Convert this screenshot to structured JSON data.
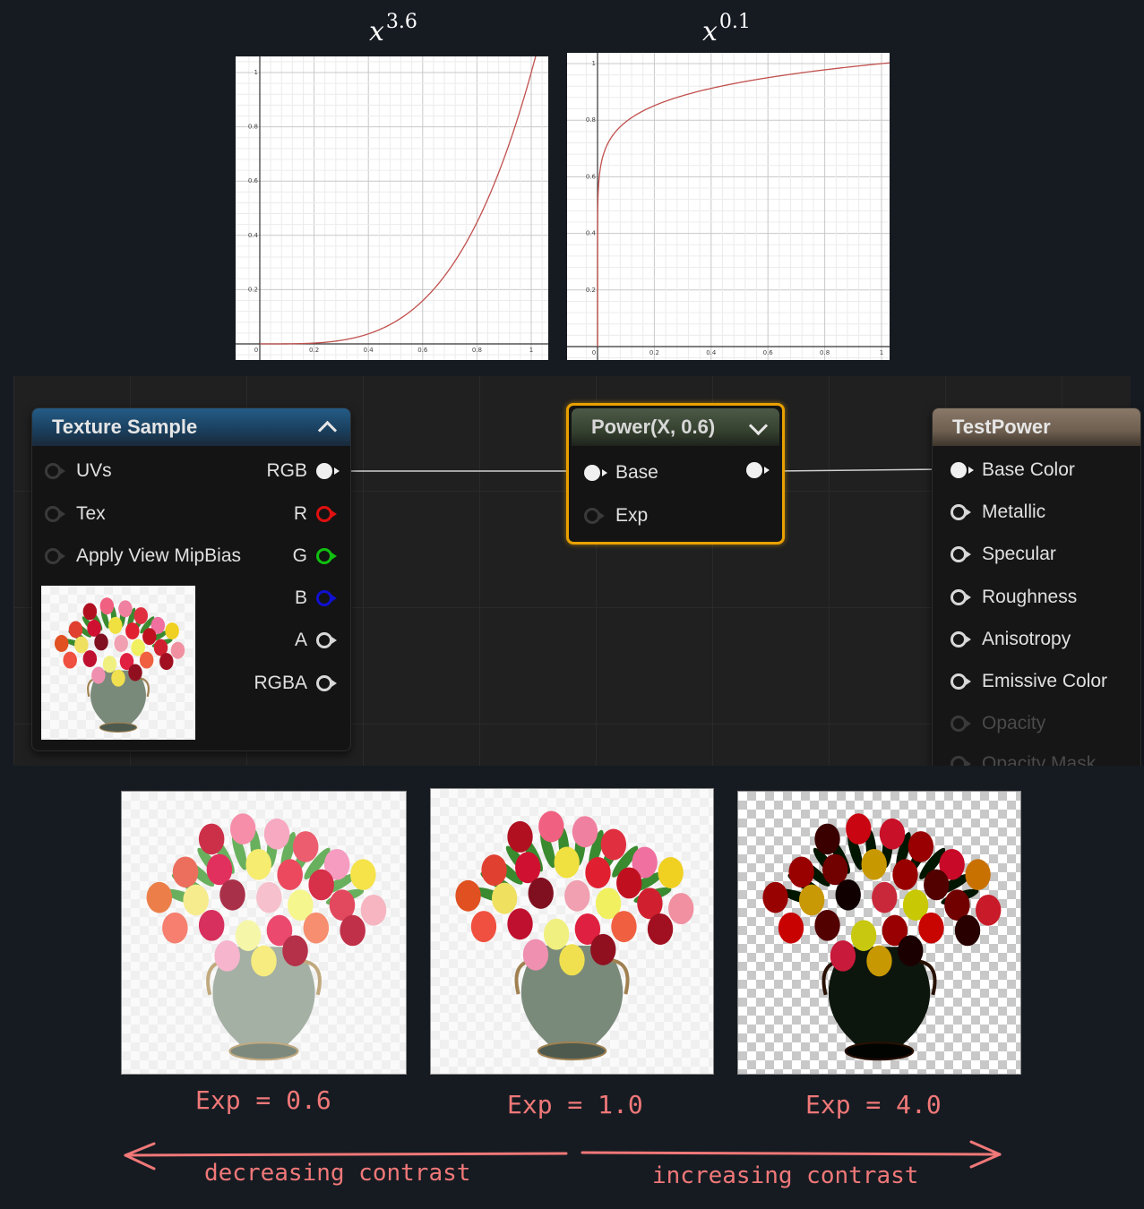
{
  "plots": [
    {
      "base": "x",
      "exponent": "3.6",
      "x_ticks": [
        "0",
        "0.2",
        "0.4",
        "0.6",
        "0.8",
        "1"
      ],
      "y_ticks": [
        "0.2",
        "0.4",
        "0.6",
        "0.8",
        "1"
      ]
    },
    {
      "base": "x",
      "exponent": "0.1",
      "x_ticks": [
        "0",
        "0.2",
        "0.4",
        "0.6",
        "0.8",
        "1"
      ],
      "y_ticks": [
        "0.2",
        "0.4",
        "0.6",
        "0.8",
        "1"
      ]
    }
  ],
  "chart_data": [
    {
      "type": "line",
      "title": "x^3.6",
      "series": [
        {
          "function": "y = x^3.6"
        }
      ],
      "xlim": [
        0,
        1
      ],
      "ylim": [
        0,
        1
      ],
      "grid": true
    },
    {
      "type": "line",
      "title": "x^0.1",
      "series": [
        {
          "function": "y = x^0.1"
        }
      ],
      "xlim": [
        0,
        1
      ],
      "ylim": [
        0,
        1
      ],
      "grid": true
    }
  ],
  "colors": {
    "curve": "#c0504d",
    "texture_header": "#1c4a6e",
    "power_border": "#e8a000",
    "result_header": "#7a6a5a",
    "annotation": "#f07878"
  },
  "texture_node": {
    "title": "Texture Sample",
    "inputs": [
      "UVs",
      "Tex",
      "Apply View MipBias"
    ],
    "outputs": [
      "RGB",
      "R",
      "G",
      "B",
      "A",
      "RGBA"
    ]
  },
  "power_node": {
    "title": "Power(X, 0.6)",
    "inputs": [
      "Base",
      "Exp"
    ]
  },
  "result_node": {
    "title": "TestPower",
    "inputs": [
      "Base Color",
      "Metallic",
      "Specular",
      "Roughness",
      "Anisotropy",
      "Emissive Color",
      "Opacity",
      "Opacity Mask"
    ]
  },
  "annotations": {
    "labels": [
      "Exp = 0.6",
      "Exp = 1.0",
      "Exp = 4.0"
    ],
    "left_arrow": "decreasing contrast",
    "right_arrow": "increasing contrast"
  }
}
